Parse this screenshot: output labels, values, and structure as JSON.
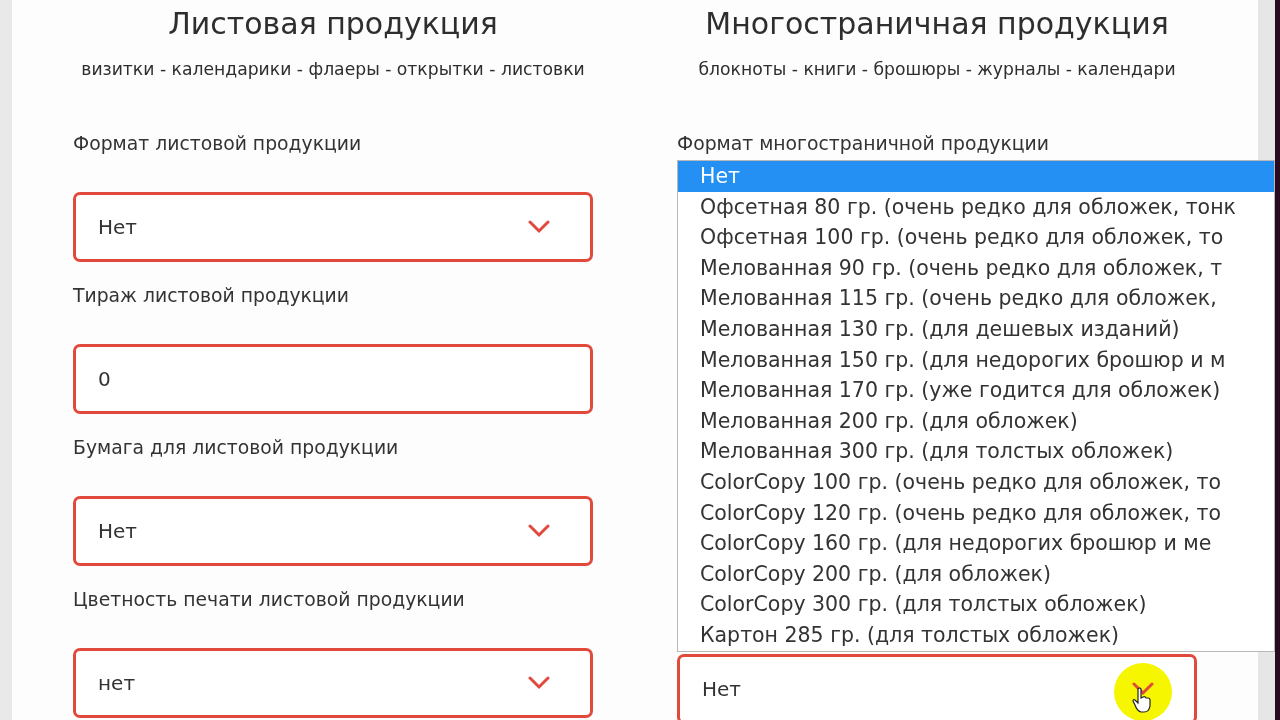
{
  "columns": [
    {
      "title": "Листовая продукция",
      "subtitle": "визитки - календарики - флаеры - открытки - листовки",
      "fields": [
        {
          "label": "Формат листовой продукции",
          "kind": "select",
          "value": "Нет"
        },
        {
          "label": "Тираж листовой продукции",
          "kind": "input",
          "value": "0"
        },
        {
          "label": "Бумага для листовой продукции",
          "kind": "select",
          "value": "Нет"
        },
        {
          "label": "Цветность печати листовой продукции",
          "kind": "select",
          "value": "нет"
        }
      ]
    },
    {
      "title": "Многостраничная продукция",
      "subtitle": "блокноты - книги - брошюры - журналы - календари",
      "fields": [
        {
          "label": "Формат многостраничной продукции",
          "kind": "select",
          "options": [
            {
              "label": "Нет",
              "selected": true
            },
            {
              "label": "Офсетная 80 гр. (очень редко для обложек, тонк",
              "selected": false
            },
            {
              "label": "Офсетная 100 гр. (очень редко для обложек, то",
              "selected": false
            },
            {
              "label": "Мелованная 90 гр. (очень редко для обложек, т",
              "selected": false
            },
            {
              "label": "Мелованная 115 гр. (очень редко для обложек,",
              "selected": false
            },
            {
              "label": "Мелованная 130 гр. (для дешевых изданий)",
              "selected": false
            },
            {
              "label": "Мелованная 150 гр. (для недорогих брошюр и м",
              "selected": false
            },
            {
              "label": "Мелованная 170 гр. (уже годится для обложек)",
              "selected": false
            },
            {
              "label": "Мелованная 200 гр. (для обложек)",
              "selected": false
            },
            {
              "label": "Мелованная 300 гр. (для толстых обложек)",
              "selected": false
            },
            {
              "label": "ColorCopy 100 гр. (очень редко для обложек, то",
              "selected": false
            },
            {
              "label": "ColorCopy 120 гр. (очень редко для обложек, то",
              "selected": false
            },
            {
              "label": "ColorCopy 160 гр. (для недорогих брошюр и ме",
              "selected": false
            },
            {
              "label": "ColorCopy 200 гр. (для обложек)",
              "selected": false
            },
            {
              "label": "ColorCopy 300 гр. (для толстых обложек)",
              "selected": false
            },
            {
              "label": "Картон 285 гр. (для толстых обложек)",
              "selected": false
            }
          ]
        },
        {
          "kind": "select",
          "value": "Нет",
          "cursor": true
        }
      ]
    }
  ]
}
